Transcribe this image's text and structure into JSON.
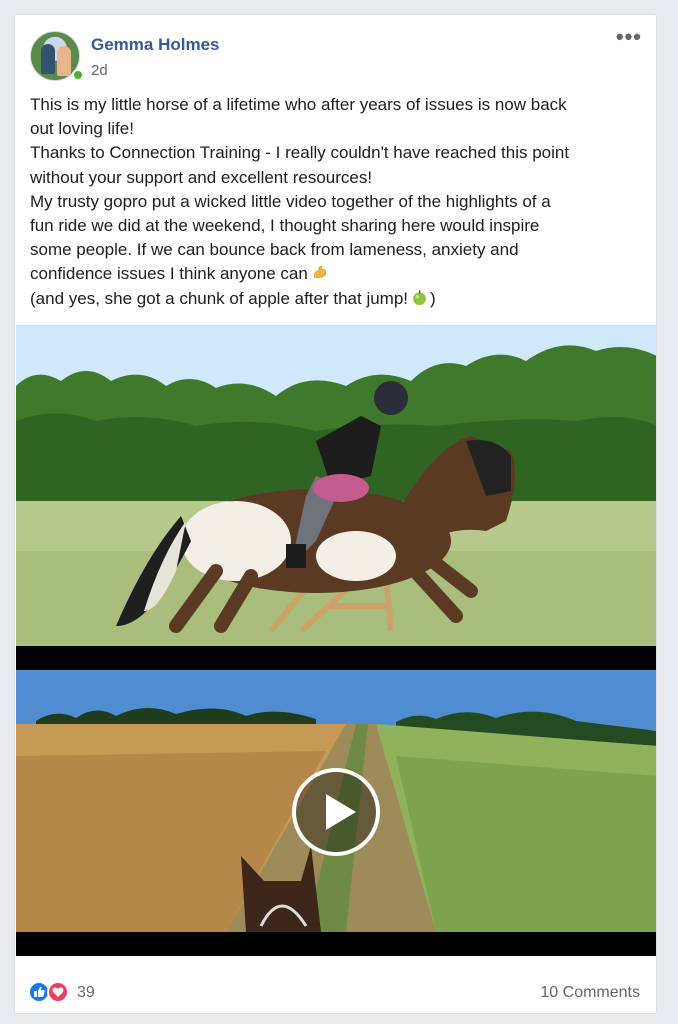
{
  "post": {
    "author": "Gemma Holmes",
    "timestamp": "2d",
    "more_icon": "more-horizontal-icon",
    "text_lines": [
      "This is my little horse of a lifetime who after years of issues is now back",
      "out loving life!",
      "Thanks to Connection Training - I really couldn't have reached this point",
      "without your support and excellent resources!",
      "My trusty gopro put a wicked little video together of the highlights of a",
      "fun ride we did at the weekend, I thought sharing here would inspire",
      "some people. If we can bounce back from lameness, anxiety and",
      "confidence issues I think anyone can",
      "(and yes, she got a chunk of apple after that jump!",
      ")"
    ],
    "media": {
      "play_icon": "play-button-icon"
    }
  },
  "footer": {
    "reaction_count": "39",
    "comments_label": "10 Comments",
    "colors": {
      "like": "#1877f2",
      "love": "#f33e58"
    }
  },
  "colors": {
    "author_link": "#385898",
    "secondary_text": "#606770",
    "online_dot": "#42b72a"
  }
}
